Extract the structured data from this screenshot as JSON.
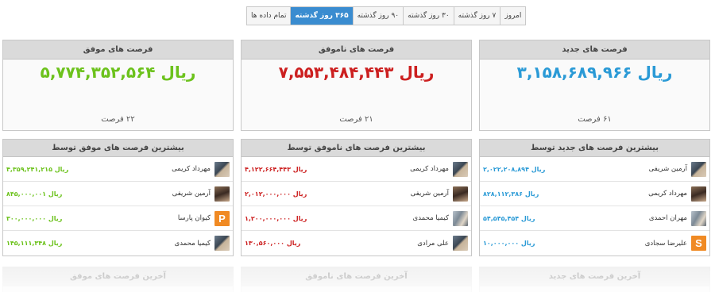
{
  "range_tabs": [
    {
      "label": "امروز",
      "active": false
    },
    {
      "label": "۷ روز گذشته",
      "active": false
    },
    {
      "label": "۳۰ روز گذشته",
      "active": false
    },
    {
      "label": "۹۰ روز گذشته",
      "active": false
    },
    {
      "label": "۳۶۵ روز گذشته",
      "active": true
    },
    {
      "label": "تمام داده ها",
      "active": false
    }
  ],
  "summaries": {
    "new": {
      "title": "فرصت های جدید",
      "amount": "ریال ۳,۱۵۸,۶۸۹,۹۶۶",
      "count": "۶۱ فرصت",
      "color": "#2a9ad6"
    },
    "lost": {
      "title": "فرصت های ناموفق",
      "amount": "ریال ۷,۵۵۳,۴۸۴,۴۴۳",
      "count": "۲۱ فرصت",
      "color": "#cc1f1f"
    },
    "won": {
      "title": "فرصت های موفق",
      "amount": "ریال ۵,۷۷۴,۳۵۲,۵۶۴",
      "count": "۲۲ فرصت",
      "color": "#6cc21c"
    }
  },
  "top_new": {
    "title": "بیشترین فرصت های جدید توسط",
    "color": "#2a9ad6",
    "rows": [
      {
        "name": "آرمین شریفی",
        "value": "ریال ۲,۰۲۲,۲۰۸,۸۹۴",
        "avatar": "photo-icon"
      },
      {
        "name": "مهرداد کریمی",
        "value": "ریال ۸۲۸,۱۱۲,۳۸۶",
        "avatar": "photo-icon"
      },
      {
        "name": "مهران احمدی",
        "value": "ریال ۵۴,۵۴۵,۴۵۴",
        "avatar": "photo-icon"
      },
      {
        "name": "علیرضا سجادی",
        "value": "ریال ۱۰,۰۰۰,۰۰۰",
        "avatar": "letter-s-icon",
        "letter": "S"
      }
    ]
  },
  "top_lost": {
    "title": "بیشترین فرصت های ناموفق توسط",
    "color": "#cc1f1f",
    "rows": [
      {
        "name": "مهرداد کریمی",
        "value": "ریال ۴,۱۲۲,۶۶۴,۴۴۳",
        "avatar": "photo-icon"
      },
      {
        "name": "آرمین شریفی",
        "value": "ریال ۲,۰۱۲,۰۰۰,۰۰۰",
        "avatar": "photo-icon"
      },
      {
        "name": "کیمیا محمدی",
        "value": "ریال ۱,۲۰۰,۰۰۰,۰۰۰",
        "avatar": "photo-icon"
      },
      {
        "name": "علی مرادی",
        "value": "ریال ۱۳۰,۵۶۰,۰۰۰",
        "avatar": "photo-icon"
      }
    ]
  },
  "top_won": {
    "title": "بیشترین فرصت های موفق توسط",
    "color": "#6cc21c",
    "rows": [
      {
        "name": "مهرداد کریمی",
        "value": "ریال ۴,۳۵۹,۲۴۱,۲۱۵",
        "avatar": "photo-icon"
      },
      {
        "name": "آرمین شریفی",
        "value": "ریال ۸۴۵,۰۰۰,۰۰۱",
        "avatar": "photo-icon"
      },
      {
        "name": "کیوان پارسا",
        "value": "ریال ۳۰۰,۰۰۰,۰۰۰",
        "avatar": "letter-p-icon",
        "letter": "P"
      },
      {
        "name": "کیمیا محمدی",
        "value": "ریال ۱۴۵,۱۱۱,۳۴۸",
        "avatar": "photo-icon"
      }
    ]
  },
  "bottom_panels": {
    "new": "آخرین فرصت های جدید",
    "lost": "آخرین فرصت های ناموفق",
    "won": "آخرین فرصت های موفق"
  }
}
